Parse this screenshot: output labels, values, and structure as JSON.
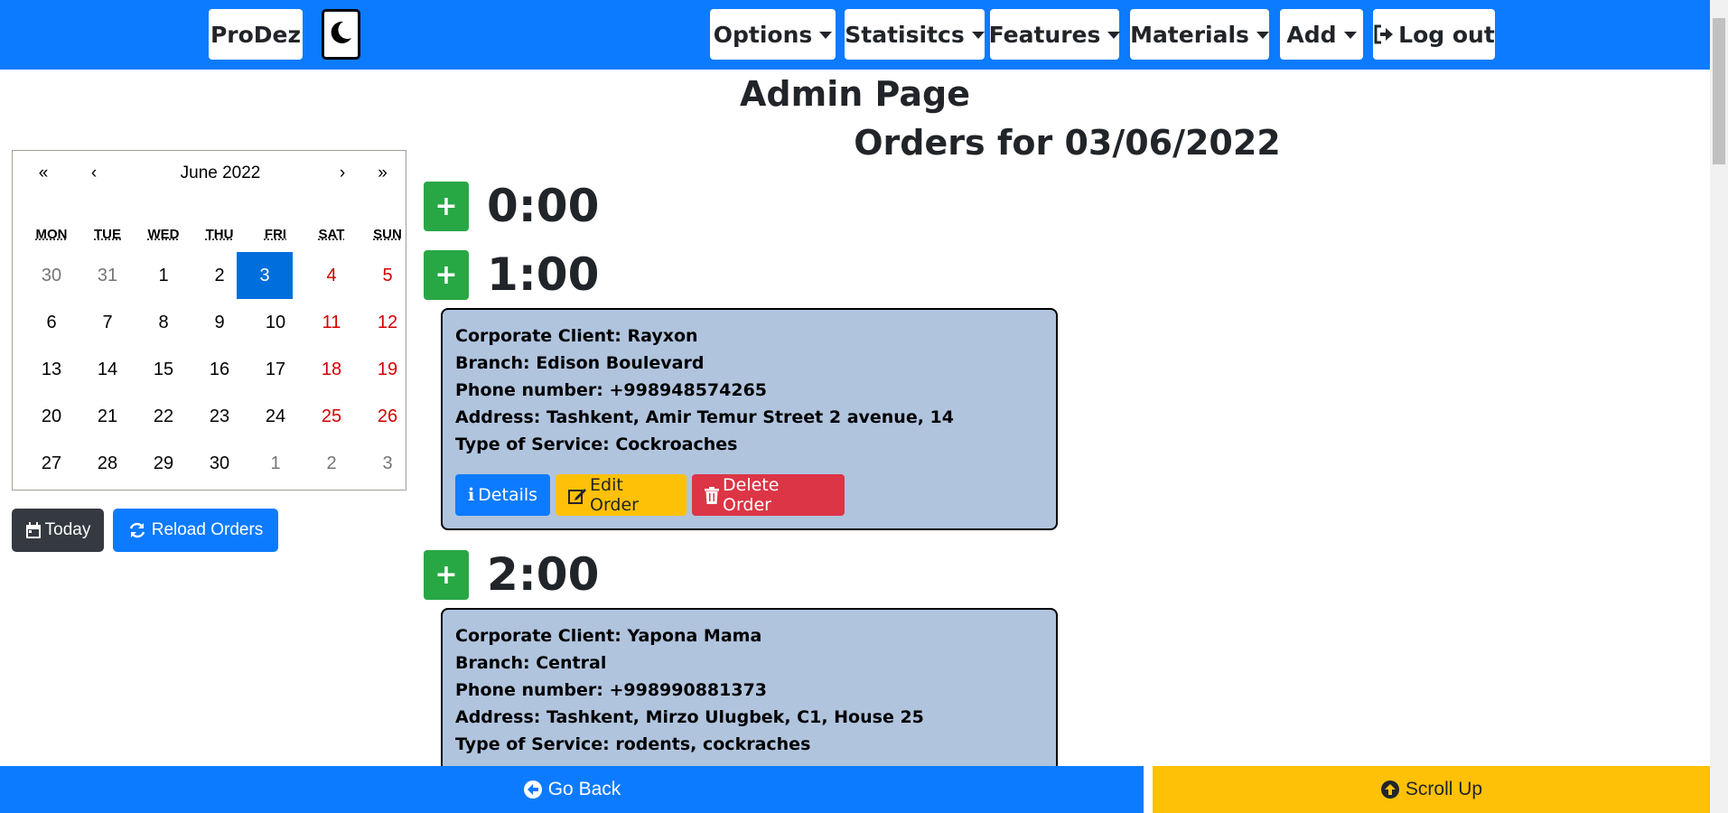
{
  "navbar": {
    "brand": "ProDez",
    "theme_icon": "moon-icon",
    "menus": [
      {
        "label": "Options"
      },
      {
        "label": "Statisitcs"
      },
      {
        "label": "Features"
      },
      {
        "label": "Materials"
      },
      {
        "label": "Add"
      }
    ],
    "logout_label": "Log out"
  },
  "page": {
    "title": "Admin Page",
    "orders_title": "Orders for 03/06/2022"
  },
  "calendar": {
    "prev_year": "«",
    "prev_month": "‹",
    "month_label": "June 2022",
    "next_month": "›",
    "next_year": "»",
    "weekdays": [
      "MON",
      "TUE",
      "WED",
      "THU",
      "FRI",
      "SAT",
      "SUN"
    ],
    "weeks": [
      [
        "30",
        "31",
        "1",
        "2",
        "3",
        "4",
        "5"
      ],
      [
        "6",
        "7",
        "8",
        "9",
        "10",
        "11",
        "12"
      ],
      [
        "13",
        "14",
        "15",
        "16",
        "17",
        "18",
        "19"
      ],
      [
        "20",
        "21",
        "22",
        "23",
        "24",
        "25",
        "26"
      ],
      [
        "27",
        "28",
        "29",
        "30",
        "1",
        "2",
        "3"
      ]
    ],
    "selected": "3"
  },
  "controls": {
    "today_label": "Today",
    "reload_label": "Reload Orders"
  },
  "hours": [
    {
      "label": "0:00"
    },
    {
      "label": "1:00"
    },
    {
      "label": "2:00"
    }
  ],
  "orders": [
    {
      "client": "Corporate Client: Rayxon",
      "branch": "Branch: Edison Boulevard",
      "phone": "Phone number: +998948574265",
      "address": "Address: Tashkent, Amir Temur Street 2 avenue, 14",
      "service": "Type of Service: Cockroaches"
    },
    {
      "client": "Corporate Client: Yapona Mama",
      "branch": "Branch: Central",
      "phone": "Phone number: +998990881373",
      "address": "Address: Tashkent, Mirzo Ulugbek, C1, House 25",
      "service": "Type of Service: rodents, cockraches"
    }
  ],
  "order_actions": {
    "details": "Details",
    "edit": "Edit Order",
    "delete": "Delete Order"
  },
  "footer": {
    "back_label": "Go Back",
    "up_label": "Scroll Up"
  },
  "colors": {
    "primary": "#0d7bff",
    "success": "#28a745",
    "warning": "#ffc107",
    "danger": "#dc3545",
    "card": "#b0c4de",
    "dark": "#343a40"
  }
}
